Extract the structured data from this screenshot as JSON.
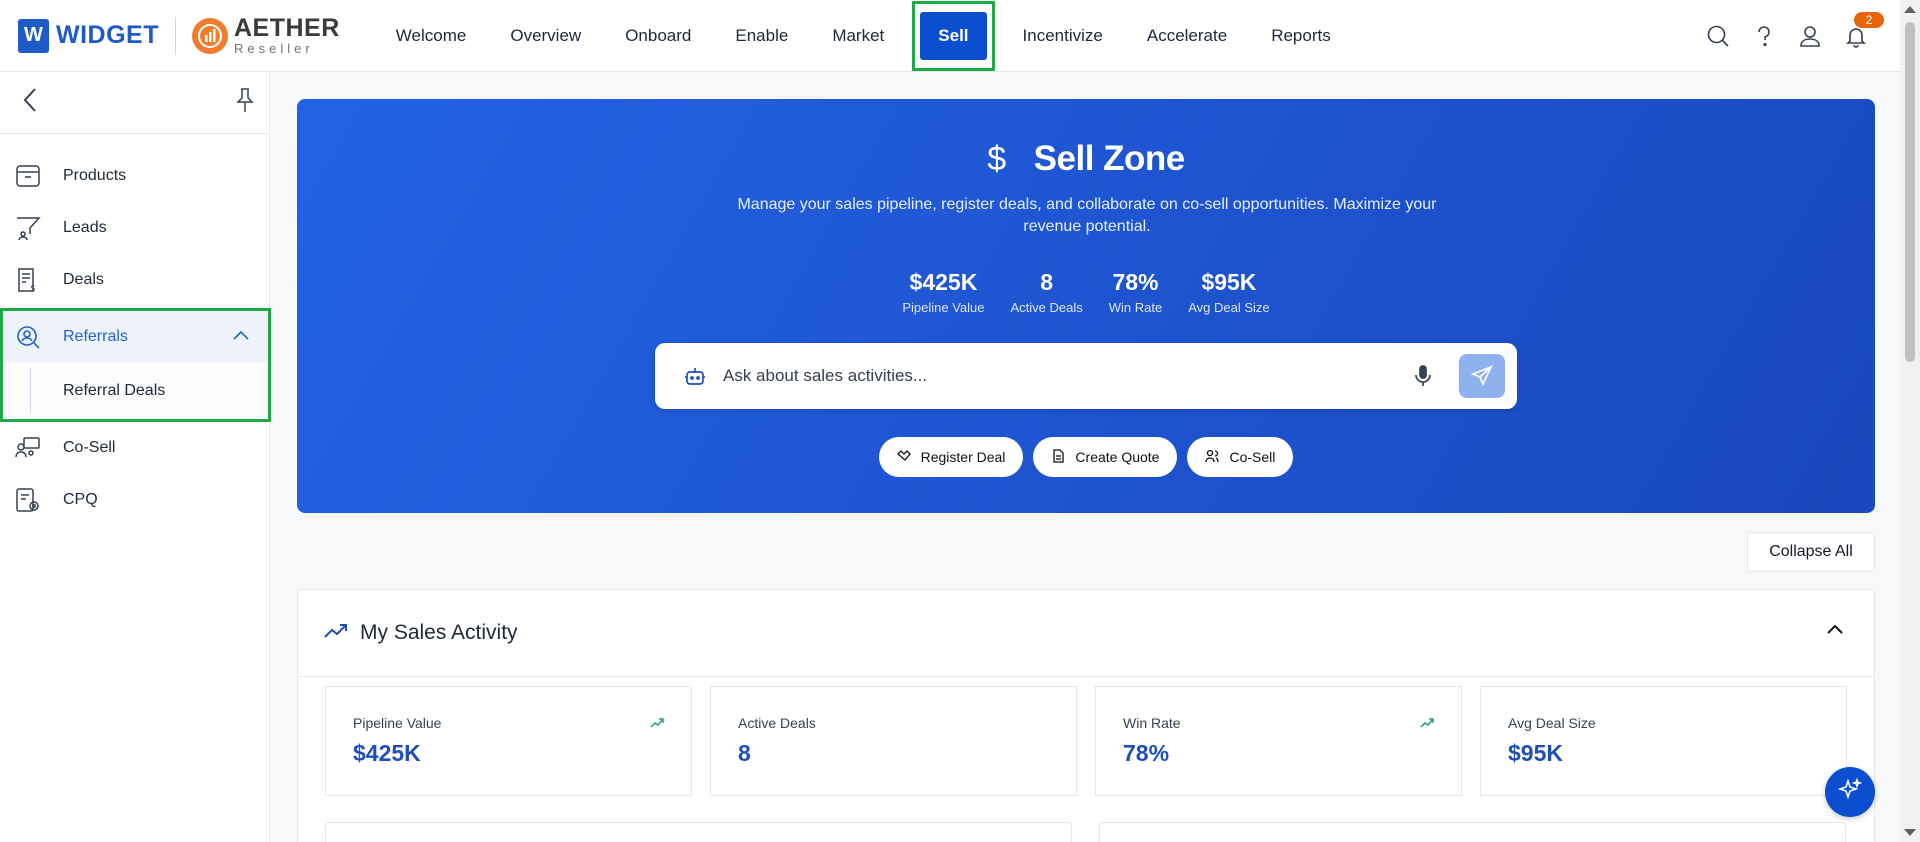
{
  "brand": {
    "widget": "WIDGET",
    "widget_badge": "W",
    "aether": "AETHER",
    "aether_sub": "Reseller"
  },
  "nav": [
    {
      "label": "Welcome"
    },
    {
      "label": "Overview"
    },
    {
      "label": "Onboard"
    },
    {
      "label": "Enable"
    },
    {
      "label": "Market"
    },
    {
      "label": "Sell",
      "active": true
    },
    {
      "label": "Incentivize"
    },
    {
      "label": "Accelerate"
    },
    {
      "label": "Reports"
    }
  ],
  "notifications": {
    "count": "2"
  },
  "sidebar": {
    "items": [
      {
        "label": "Products",
        "icon": "box-icon"
      },
      {
        "label": "Leads",
        "icon": "funnel-icon"
      },
      {
        "label": "Deals",
        "icon": "invoice-dollar-icon"
      },
      {
        "label": "Referrals",
        "icon": "user-search-icon",
        "expanded": true
      },
      {
        "label": "Co-Sell",
        "icon": "group-icon"
      },
      {
        "label": "CPQ",
        "icon": "quote-settings-icon"
      }
    ],
    "sub_items": [
      {
        "label": "Referral Deals"
      }
    ]
  },
  "hero": {
    "title": "Sell Zone",
    "description": "Manage your sales pipeline, register deals, and collaborate on co-sell opportunities. Maximize your revenue potential.",
    "stats": [
      {
        "value": "$425K",
        "label": "Pipeline Value"
      },
      {
        "value": "8",
        "label": "Active Deals"
      },
      {
        "value": "78%",
        "label": "Win Rate"
      },
      {
        "value": "$95K",
        "label": "Avg Deal Size"
      }
    ],
    "ask_placeholder": "Ask about sales activities...",
    "actions": [
      {
        "label": "Register Deal"
      },
      {
        "label": "Create Quote"
      },
      {
        "label": "Co-Sell"
      }
    ]
  },
  "collapse_all": "Collapse All",
  "activity": {
    "title": "My Sales Activity",
    "cards": [
      {
        "label": "Pipeline Value",
        "value": "$425K",
        "trend": true
      },
      {
        "label": "Active Deals",
        "value": "8",
        "trend": false
      },
      {
        "label": "Win Rate",
        "value": "78%",
        "trend": true
      },
      {
        "label": "Avg Deal Size",
        "value": "$95K",
        "trend": false
      }
    ]
  },
  "colors": {
    "brand_blue": "#0b4fd0",
    "highlight_green": "#1ea84a",
    "badge_orange": "#e8650a",
    "trend_green": "#22a06b"
  }
}
